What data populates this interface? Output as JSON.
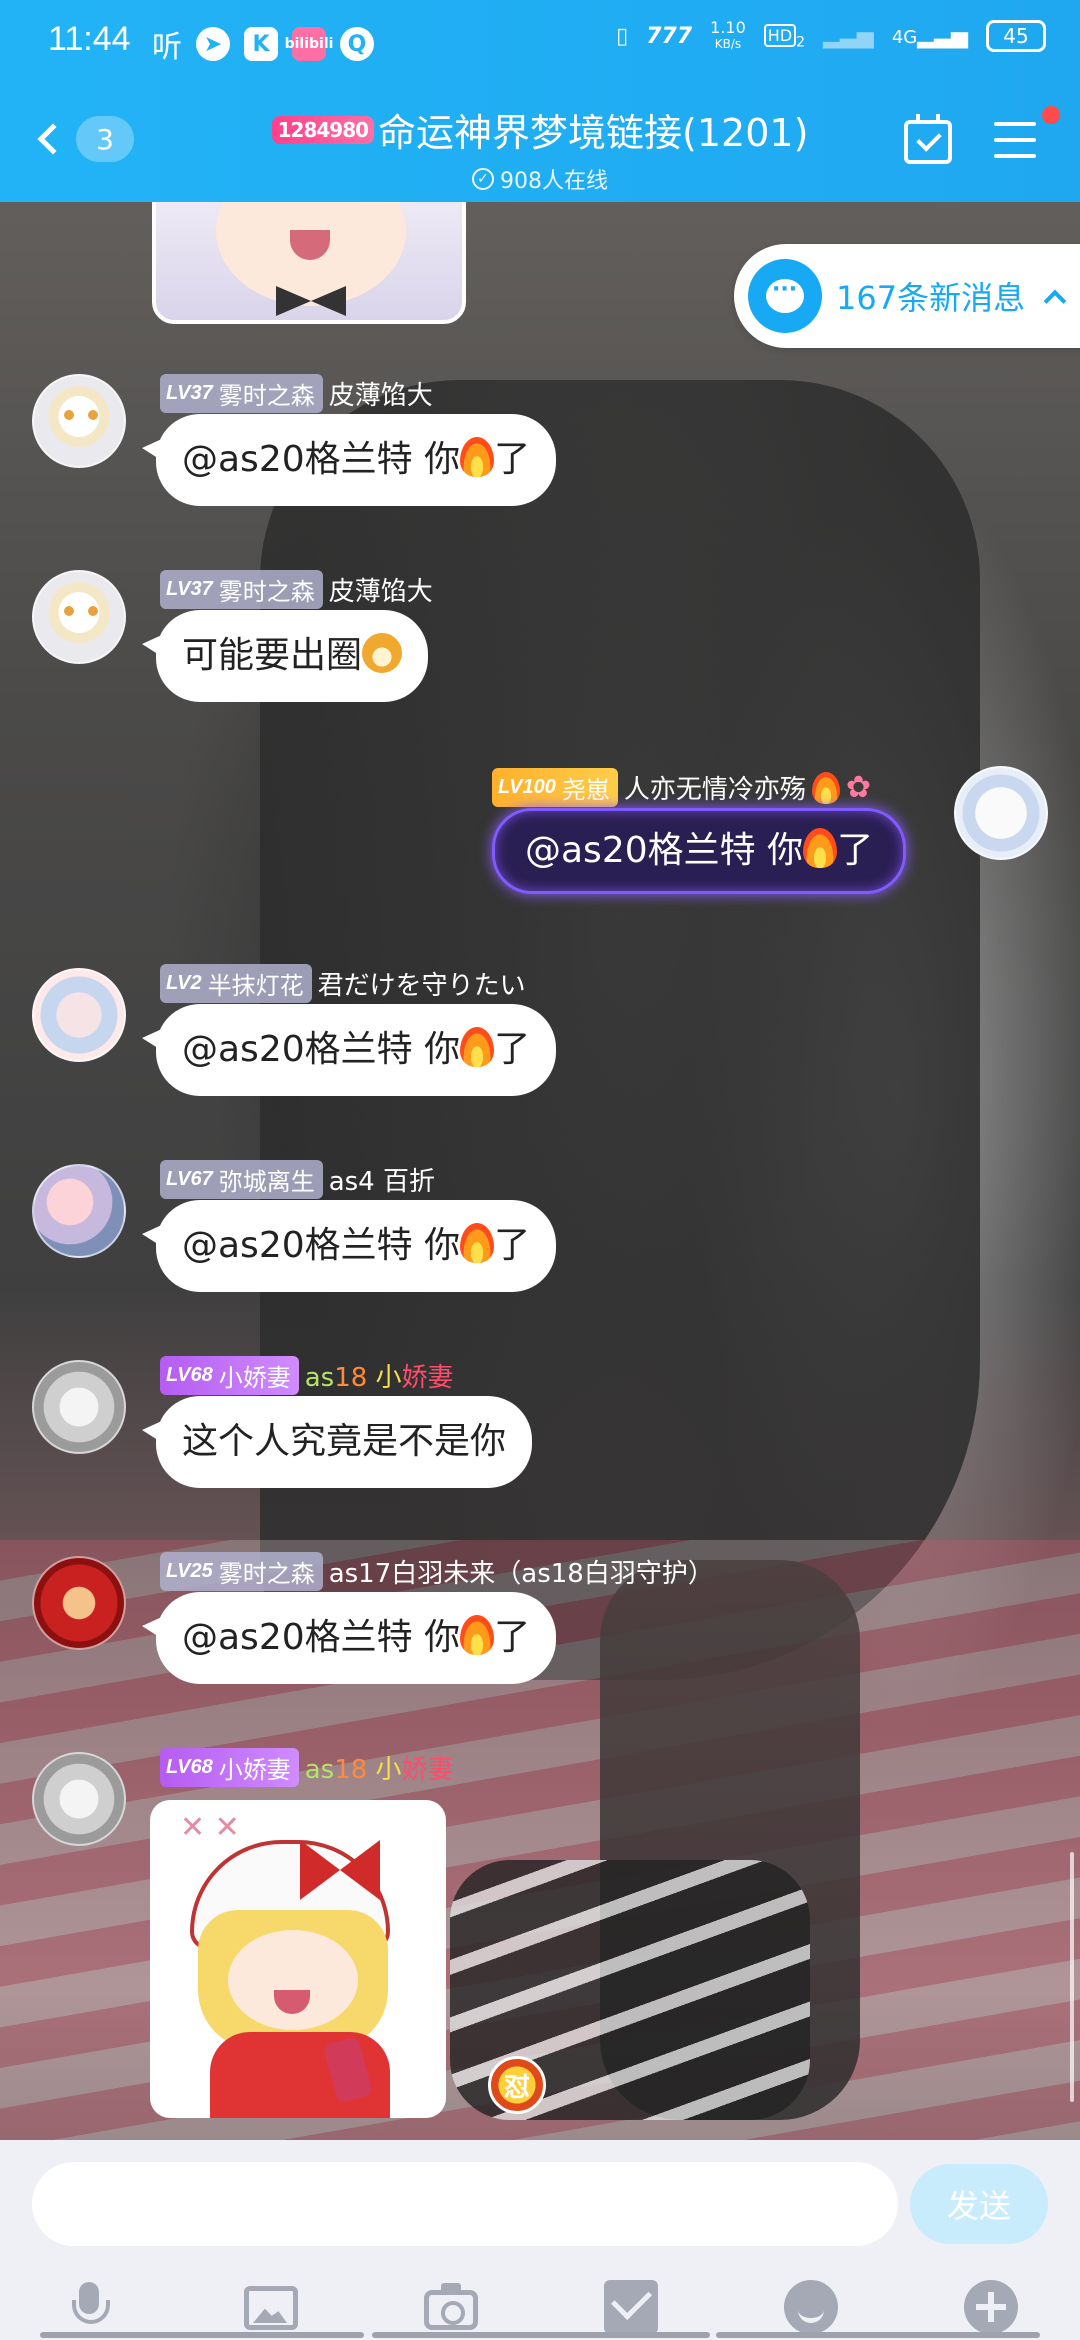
{
  "status_bar": {
    "time": "11:44",
    "app_icons": [
      "听",
      "K",
      "bilibili",
      "Q"
    ],
    "net_speed_value": "1.10",
    "net_speed_unit": "KB/s",
    "hd_label": "HD",
    "hd_sub": "2",
    "signal_label": "4G",
    "battery": "45"
  },
  "header": {
    "back_count": "3",
    "title_badge": "1284980",
    "title": "命运神界梦境链接(1201)",
    "online": "908人在线"
  },
  "new_messages": {
    "label": "167条新消息"
  },
  "messages": [
    {
      "lv": "LV37",
      "title": "雾时之森",
      "nick": "皮薄馅大",
      "text_before": "@as20格兰特 你",
      "text_after": "了"
    },
    {
      "lv": "LV37",
      "title": "雾时之森",
      "nick": "皮薄馅大",
      "text_before": "可能要出圈",
      "text_after": ""
    },
    {
      "lv": "LV100",
      "title": "尧崽",
      "nick": "人亦无情冷亦殇",
      "text_before": "@as20格兰特 你",
      "text_after": "了"
    },
    {
      "lv": "LV2",
      "title": "半抹灯花",
      "nick": "君だけを守りたい",
      "text_before": "@as20格兰特 你",
      "text_after": "了"
    },
    {
      "lv": "LV67",
      "title": "弥城离生",
      "nick": "as4 百折",
      "text_before": "@as20格兰特 你",
      "text_after": "了"
    },
    {
      "lv": "LV68",
      "title": "小娇妻",
      "nick_parts": [
        "as",
        "18",
        " 小",
        "娇妻"
      ],
      "text_before": "这个人究竟是不是你",
      "text_after": ""
    },
    {
      "lv": "LV25",
      "title": "雾时之森",
      "nick": "as17白羽未来（as18白羽守护）",
      "text_before": "@as20格兰特 你",
      "text_after": "了"
    },
    {
      "lv": "LV68",
      "title": "小娇妻",
      "nick_parts": [
        "as",
        "18",
        " 小",
        "娇妻"
      ],
      "image": "sticker",
      "badge": "怼"
    }
  ],
  "input": {
    "placeholder": "",
    "value": "",
    "send_label": "发送"
  },
  "toolbar_icons": [
    "mic-icon",
    "picture-icon",
    "camera-icon",
    "red-packet-icon",
    "emoji-icon",
    "plus-icon"
  ],
  "colors": {
    "accent": "#22b3f6",
    "bubble": "#ffffff",
    "send_disabled": "#c9ecfd"
  }
}
